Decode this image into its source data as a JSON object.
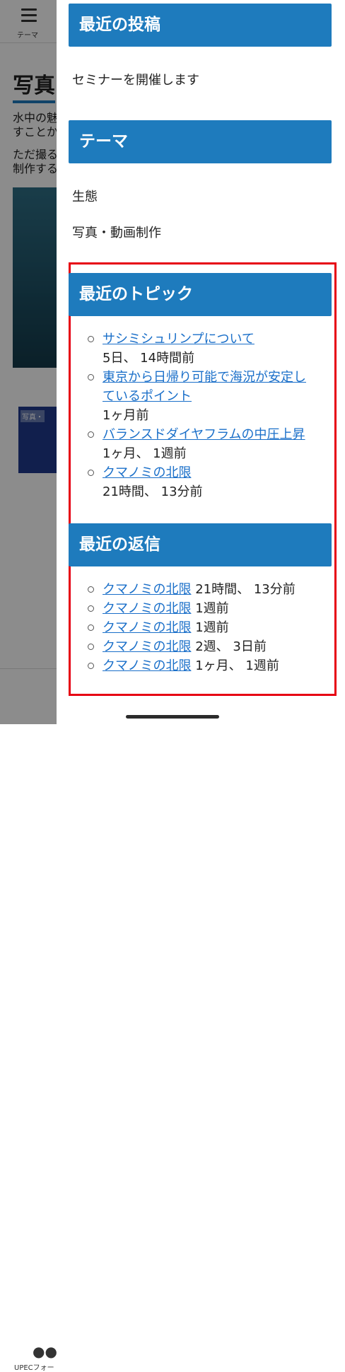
{
  "background": {
    "menu_label": "テーマ",
    "title": "写真",
    "text1": "水中の魅",
    "text2": "すことか",
    "text3": "ただ撮る",
    "text4": "制作する",
    "thumb_badge": "写真・",
    "bottom_nav_label": "UPECフォー"
  },
  "drawer": {
    "recent_posts": {
      "heading": "最近の投稿",
      "items": [
        "セミナーを開催します"
      ]
    },
    "themes": {
      "heading": "テーマ",
      "items": [
        "生態",
        "写真・動画制作"
      ]
    },
    "recent_topics": {
      "heading": "最近のトピック",
      "items": [
        {
          "title": "サシミシュリンプについて",
          "time": "5日、 14時間前"
        },
        {
          "title": "東京から日帰り可能で海況が安定しているポイント",
          "time": "1ヶ月前"
        },
        {
          "title": "バランスドダイヤフラムの中圧上昇",
          "time": "1ヶ月、 1週前"
        },
        {
          "title": "クマノミの北限",
          "time": "21時間、 13分前"
        }
      ]
    },
    "recent_replies": {
      "heading": "最近の返信",
      "items": [
        {
          "title": "クマノミの北限",
          "time": "21時間、 13分前"
        },
        {
          "title": "クマノミの北限",
          "time": "1週前"
        },
        {
          "title": "クマノミの北限",
          "time": "1週前"
        },
        {
          "title": "クマノミの北限",
          "time": "2週、 3日前"
        },
        {
          "title": "クマノミの北限",
          "time": "1ヶ月、 1週前"
        }
      ]
    }
  },
  "colors": {
    "accent": "#1e7bbd",
    "link": "#1a6fc9",
    "highlight_border": "#e60012"
  }
}
